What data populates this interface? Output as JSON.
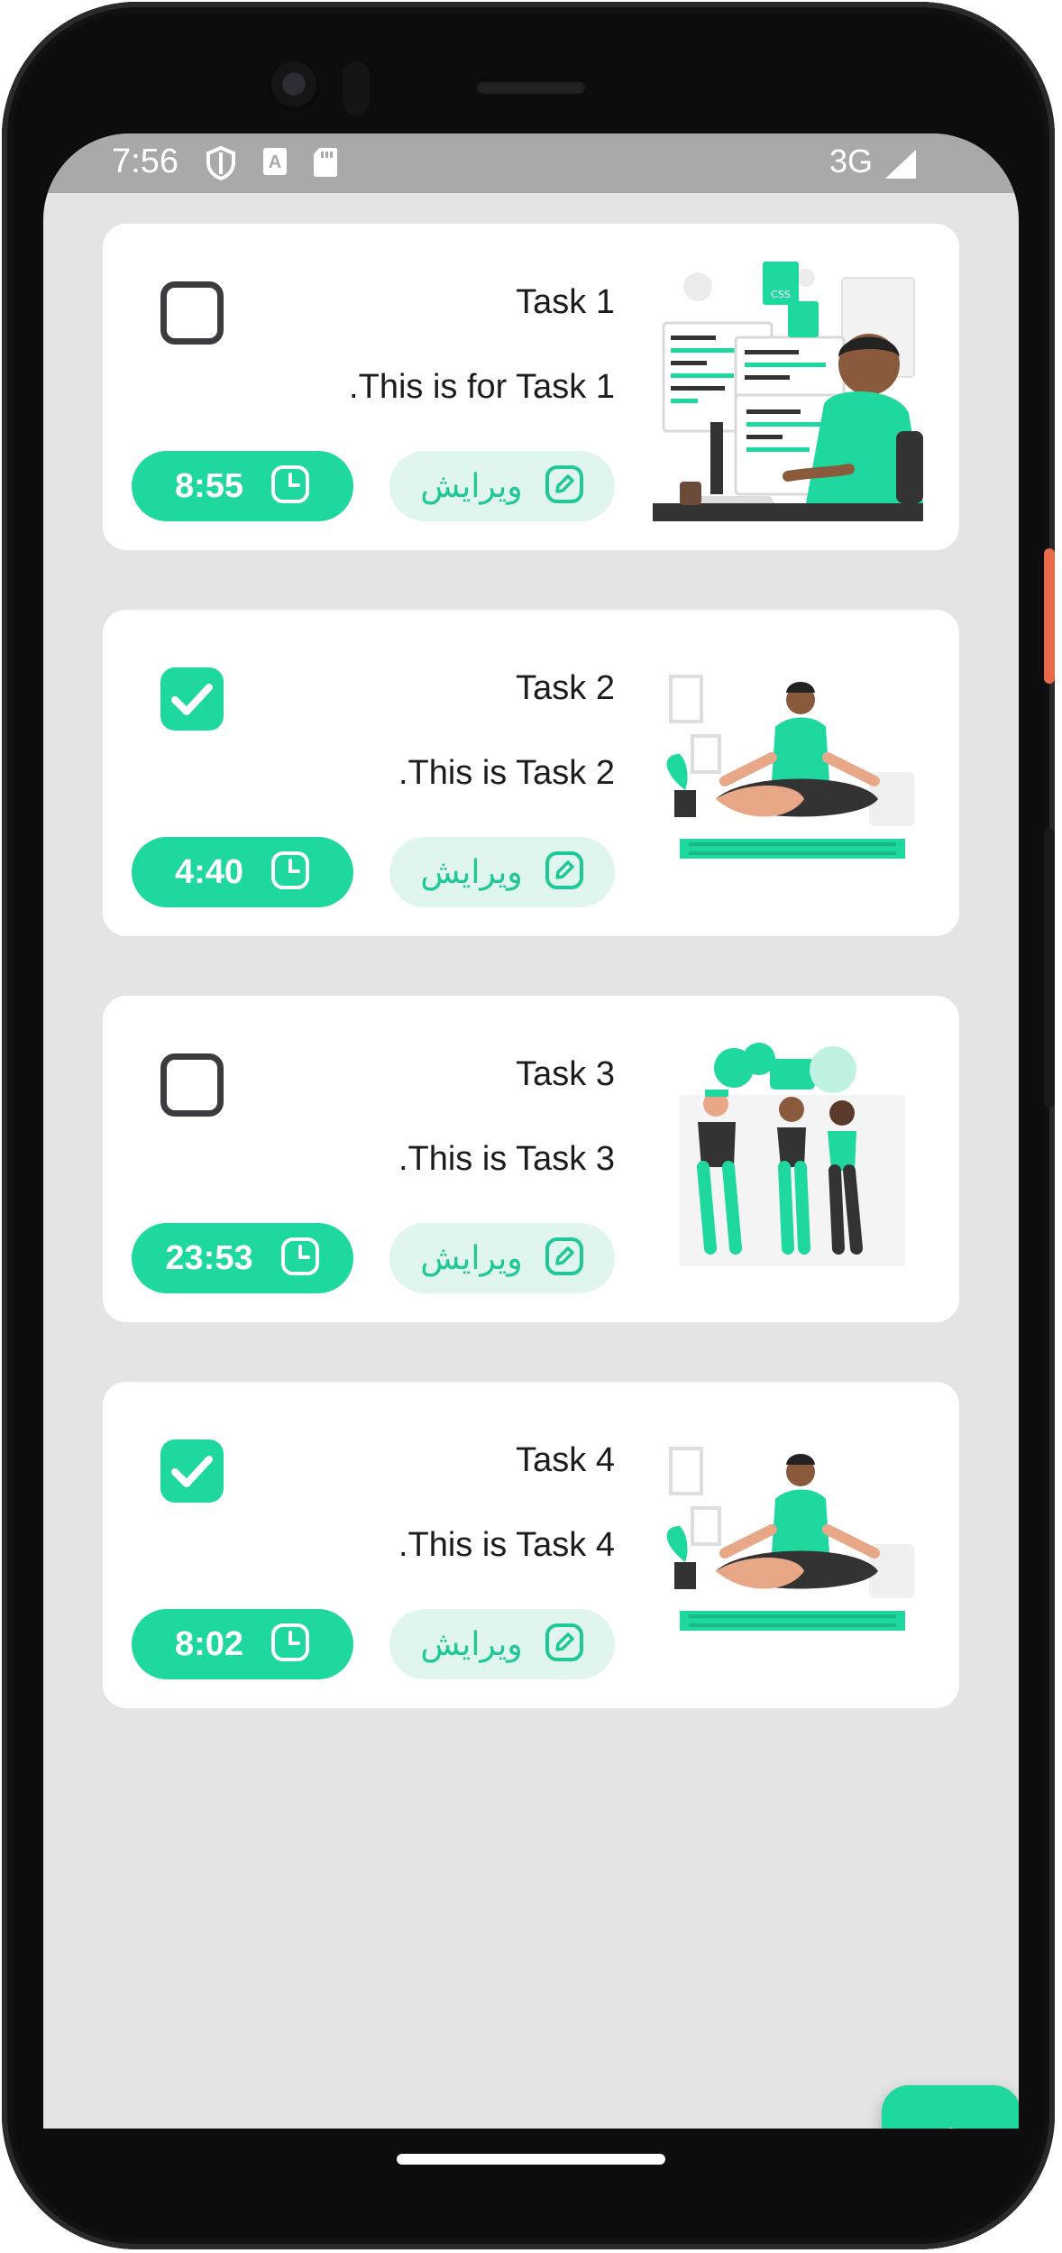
{
  "status_bar": {
    "time": "7:56",
    "network": "3G"
  },
  "colors": {
    "accent": "#1fd8a0",
    "accent_light": "#dff5ee",
    "screen_bg": "#e4e4e4",
    "checkbox_border": "#3b3b42"
  },
  "edit_label": "ویرایش",
  "tasks": [
    {
      "title": "Task 1",
      "description": ".This is for Task 1",
      "time": "8:55",
      "done": false,
      "illustration": "developer-illustration"
    },
    {
      "title": "Task 2",
      "description": ".This is Task 2",
      "time": "4:40",
      "done": true,
      "illustration": "meditation-illustration"
    },
    {
      "title": "Task 3",
      "description": ".This is Task 3",
      "time": "23:53",
      "done": false,
      "illustration": "chatting-people-illustration"
    },
    {
      "title": "Task 4",
      "description": ".This is Task 4",
      "time": "8:02",
      "done": true,
      "illustration": "meditation-illustration"
    }
  ],
  "fab": {
    "icon": "plus-icon"
  }
}
